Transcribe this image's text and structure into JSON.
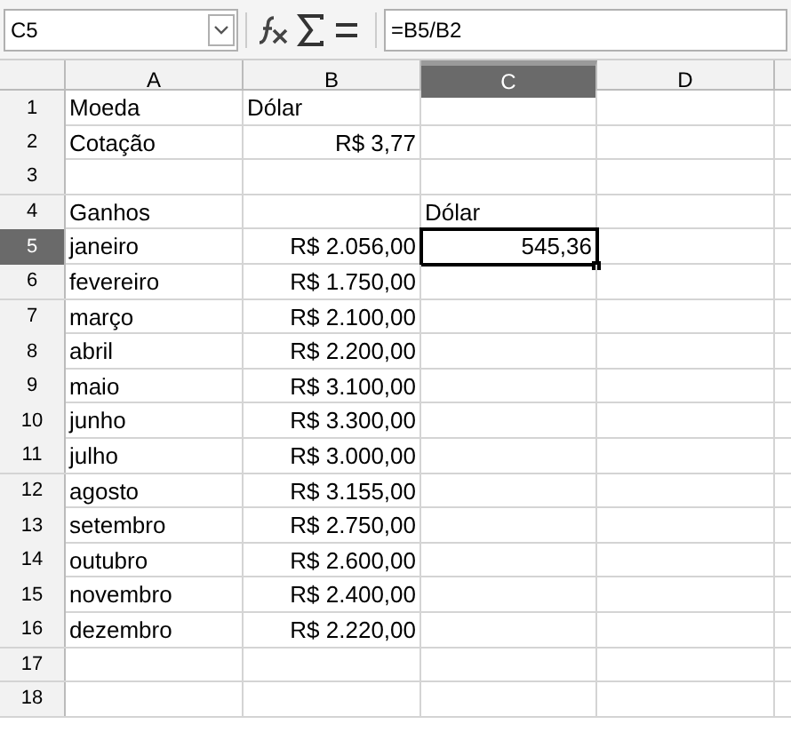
{
  "name_box": "C5",
  "formula": "=B5/B2",
  "columns": [
    {
      "label": "A",
      "selected": false
    },
    {
      "label": "B",
      "selected": false
    },
    {
      "label": "C",
      "selected": true
    },
    {
      "label": "D",
      "selected": false
    }
  ],
  "rows": [
    {
      "number": "1",
      "selected": false,
      "cells": [
        {
          "text": "Moeda",
          "kind": "text"
        },
        {
          "text": "Dólar",
          "kind": "text"
        },
        {},
        {}
      ]
    },
    {
      "number": "2",
      "selected": false,
      "cells": [
        {
          "text": "Cotação",
          "kind": "text"
        },
        {
          "text": "R$ 3,77",
          "kind": "number"
        },
        {},
        {}
      ]
    },
    {
      "number": "3",
      "selected": false,
      "cells": [
        {},
        {},
        {},
        {}
      ]
    },
    {
      "number": "4",
      "selected": false,
      "cells": [
        {
          "text": "Ganhos",
          "kind": "text"
        },
        {},
        {
          "text": "Dólar",
          "kind": "text"
        },
        {}
      ]
    },
    {
      "number": "5",
      "selected": true,
      "cells": [
        {
          "text": "janeiro",
          "kind": "text"
        },
        {
          "text": "R$ 2.056,00",
          "kind": "number"
        },
        {
          "text": "545,36",
          "kind": "number",
          "selected": true
        },
        {}
      ]
    },
    {
      "number": "6",
      "selected": false,
      "cells": [
        {
          "text": "fevereiro",
          "kind": "text"
        },
        {
          "text": "R$ 1.750,00",
          "kind": "number"
        },
        {},
        {}
      ]
    },
    {
      "number": "7",
      "selected": false,
      "cells": [
        {
          "text": "março",
          "kind": "text"
        },
        {
          "text": "R$ 2.100,00",
          "kind": "number"
        },
        {},
        {}
      ]
    },
    {
      "number": "8",
      "selected": false,
      "cells": [
        {
          "text": "abril",
          "kind": "text"
        },
        {
          "text": "R$ 2.200,00",
          "kind": "number"
        },
        {},
        {}
      ]
    },
    {
      "number": "9",
      "selected": false,
      "cells": [
        {
          "text": "maio",
          "kind": "text"
        },
        {
          "text": "R$ 3.100,00",
          "kind": "number"
        },
        {},
        {}
      ]
    },
    {
      "number": "10",
      "selected": false,
      "cells": [
        {
          "text": "junho",
          "kind": "text"
        },
        {
          "text": "R$ 3.300,00",
          "kind": "number"
        },
        {},
        {}
      ]
    },
    {
      "number": "11",
      "selected": false,
      "cells": [
        {
          "text": "julho",
          "kind": "text"
        },
        {
          "text": "R$ 3.000,00",
          "kind": "number"
        },
        {},
        {}
      ]
    },
    {
      "number": "12",
      "selected": false,
      "cells": [
        {
          "text": "agosto",
          "kind": "text"
        },
        {
          "text": "R$ 3.155,00",
          "kind": "number"
        },
        {},
        {}
      ]
    },
    {
      "number": "13",
      "selected": false,
      "cells": [
        {
          "text": "setembro",
          "kind": "text"
        },
        {
          "text": "R$ 2.750,00",
          "kind": "number"
        },
        {},
        {}
      ]
    },
    {
      "number": "14",
      "selected": false,
      "cells": [
        {
          "text": "outubro",
          "kind": "text"
        },
        {
          "text": "R$ 2.600,00",
          "kind": "number"
        },
        {},
        {}
      ]
    },
    {
      "number": "15",
      "selected": false,
      "cells": [
        {
          "text": "novembro",
          "kind": "text"
        },
        {
          "text": "R$ 2.400,00",
          "kind": "number"
        },
        {},
        {}
      ]
    },
    {
      "number": "16",
      "selected": false,
      "cells": [
        {
          "text": "dezembro",
          "kind": "text"
        },
        {
          "text": "R$ 2.220,00",
          "kind": "number"
        },
        {},
        {}
      ]
    },
    {
      "number": "17",
      "selected": false,
      "cells": [
        {},
        {},
        {},
        {}
      ]
    },
    {
      "number": "18",
      "selected": false,
      "cells": [
        {},
        {},
        {},
        {}
      ]
    }
  ]
}
